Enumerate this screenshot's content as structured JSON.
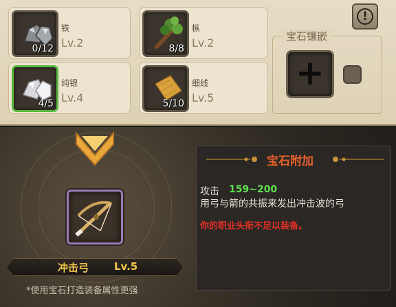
{
  "materials": [
    {
      "name": "铁",
      "level": "Lv.2",
      "count": "0/12",
      "icon": "iron-ore-icon"
    },
    {
      "name": "枞",
      "level": "Lv.2",
      "count": "8/8",
      "icon": "fir-branch-icon"
    },
    {
      "name": "纯银",
      "level": "Lv.4",
      "count": "4/5",
      "icon": "silver-ore-icon"
    },
    {
      "name": "细线",
      "level": "Lv.5",
      "count": "5/10",
      "icon": "fine-thread-icon"
    }
  ],
  "gem_inlay": {
    "title": "宝石镶嵌",
    "add_icon": "plus-icon"
  },
  "info_icon": "exclamation-icon",
  "item": {
    "name": "冲击弓",
    "level": "Lv.5",
    "icon": "crossbow-icon"
  },
  "hint": "*使用宝石打造装备属性更强",
  "panel": {
    "title": "宝石附加",
    "stat_label": "攻击",
    "stat_value": "159~200",
    "description": "用弓与箭的共振来发出冲击波的弓",
    "warning": "你的职业头衔不足以装备。"
  },
  "colors": {
    "warning": "#e53027",
    "stat": "#5fe04a",
    "title": "#e8612a",
    "item_name": "#f0c64a",
    "selected_border": "#58b63d"
  }
}
